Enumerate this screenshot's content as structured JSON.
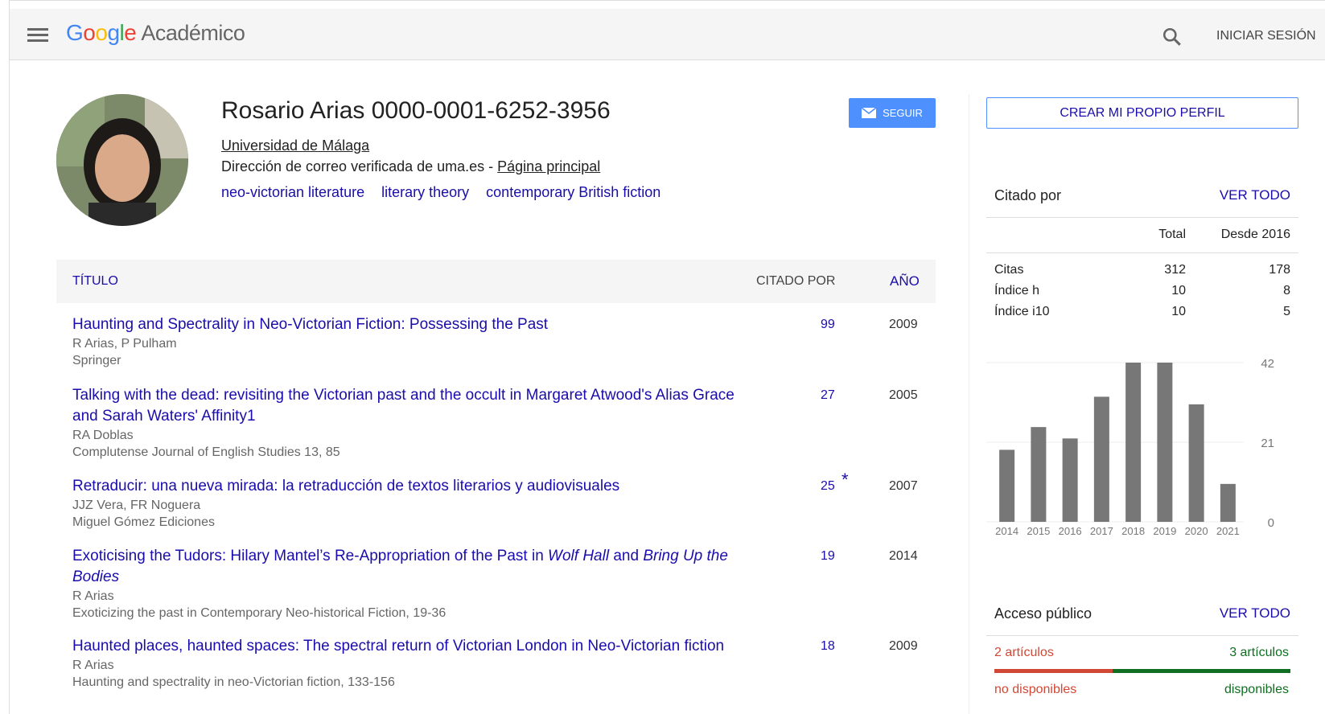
{
  "header": {
    "logo": [
      "G",
      "o",
      "o",
      "g",
      "l",
      "e"
    ],
    "product": "Académico",
    "signin": "INICIAR SESIÓN"
  },
  "profile": {
    "name": "Rosario Arias 0000-0001-6252-3956",
    "affiliation": "Universidad de Málaga",
    "email_text": "Dirección de correo verificada de uma.es - ",
    "homepage": "Página principal",
    "interests": [
      "neo-victorian literature",
      "literary theory",
      "contemporary British fiction"
    ],
    "follow_label": "SEGUIR"
  },
  "table": {
    "col_title": "TÍTULO",
    "col_cited": "CITADO POR",
    "col_year": "AÑO",
    "rows": [
      {
        "title": "Haunting and Spectrality in Neo-Victorian Fiction: Possessing the Past",
        "authors": "R Arias, P Pulham",
        "pub": "Springer",
        "cites": "99",
        "year": "2009"
      },
      {
        "title": "Talking with the dead: revisiting the Victorian past and the occult in Margaret Atwood's Alias Grace and Sarah Waters' Affinity1",
        "authors": "RA Doblas",
        "pub": "Complutense Journal of English Studies 13, 85",
        "cites": "27",
        "year": "2005"
      },
      {
        "title": "Retraducir: una nueva mirada: la retraducción de textos literarios y audiovisuales",
        "authors": "JJZ Vera, FR Noguera",
        "pub": "Miguel Gómez Ediciones",
        "cites": "25",
        "star": "*",
        "year": "2007"
      },
      {
        "title_a": "Exoticising the Tudors: Hilary Mantel’s Re-Appropriation of the Past in ",
        "title_b": "Wolf Hall",
        "title_c": " and ",
        "title_d": "Bring Up the Bodies",
        "authors": "R Arias",
        "pub": "Exoticizing the past in Contemporary Neo-historical Fiction, 19-36",
        "cites": "19",
        "year": "2014"
      },
      {
        "title": "Haunted places, haunted spaces: The spectral return of Victorian London in Neo-Victorian fiction",
        "authors": "R Arias",
        "pub": "Haunting and spectrality in neo-Victorian fiction, 133-156",
        "cites": "18",
        "year": "2009"
      }
    ]
  },
  "sidebar": {
    "create_profile": "CREAR MI PROPIO PERFIL",
    "cited_by": "Citado por",
    "view_all": "VER TODO",
    "col_total": "Total",
    "col_since": "Desde 2016",
    "stats": [
      {
        "label": "Citas",
        "total": "312",
        "since": "178"
      },
      {
        "label": "Índice h",
        "total": "10",
        "since": "8"
      },
      {
        "label": "Índice i10",
        "total": "10",
        "since": "5"
      }
    ],
    "public_access": "Acceso público",
    "view_all_2": "VER TODO",
    "unavailable_count": "2 artículos",
    "available_count": "3 artículos",
    "unavailable_label": "no disponibles",
    "available_label": "disponibles",
    "unavailable_fraction": 0.4
  },
  "chart_data": {
    "type": "bar",
    "categories": [
      "2014",
      "2015",
      "2016",
      "2017",
      "2018",
      "2019",
      "2020",
      "2021"
    ],
    "values": [
      19,
      25,
      22,
      33,
      42,
      42,
      31,
      10
    ],
    "ylim": [
      0,
      42
    ],
    "yticks": [
      "0",
      "21",
      "42"
    ],
    "bar_color": "#777777",
    "grid": true
  }
}
